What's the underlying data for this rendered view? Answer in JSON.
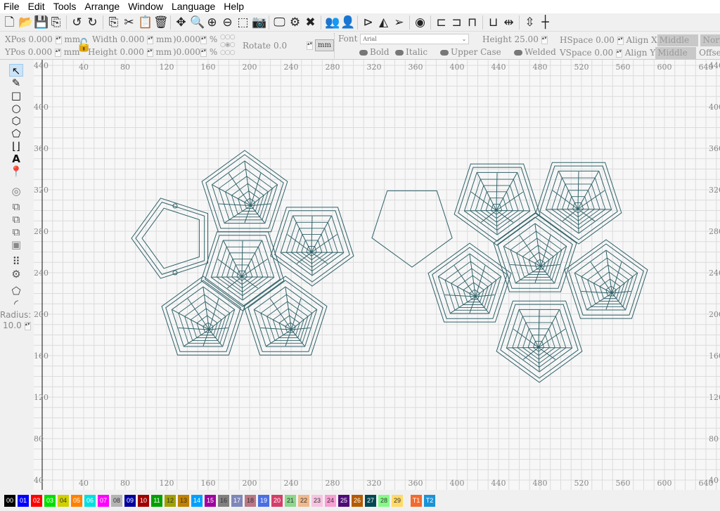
{
  "menu": [
    "File",
    "Edit",
    "Tools",
    "Arrange",
    "Window",
    "Language",
    "Help"
  ],
  "toolbar_icons": [
    "new-file",
    "open-folder",
    "save",
    "import",
    "undo",
    "redo",
    "copy",
    "cut",
    "paste",
    "delete",
    "move",
    "zoom-fit",
    "zoom-in",
    "zoom-out",
    "select-region",
    "camera",
    "monitor",
    "settings",
    "tools",
    "group",
    "user",
    "mirror-h",
    "mirror-v",
    "send",
    "target",
    "align-left",
    "align-center",
    "align-top",
    "align-middle",
    "distribute-h",
    "distribute-v",
    "dock"
  ],
  "props": {
    "xpos_label": "XPos",
    "xpos": "0.000",
    "ypos_label": "YPos",
    "ypos": "0.000",
    "unit": "mm",
    "width_label": "Width",
    "width": "0.000",
    "height_label": "Height",
    "height": "0.000",
    "scale_w": ")0.000",
    "scale_h": ")0.000",
    "pct": "%",
    "rotate_label": "Rotate",
    "rotate": "0.0",
    "units_button": "mm",
    "font_label": "Font",
    "font": "Arial",
    "text_height_label": "Height",
    "text_height": "25.00",
    "hspace_label": "HSpace",
    "hspace": "0.00",
    "vspace_label": "VSpace",
    "vspace": "0.00",
    "alignx_label": "Align X",
    "alignx": "Middle",
    "aligny_label": "Align Y",
    "aligny": "Middle",
    "normal": "Norma",
    "offset": "Offse",
    "bold": "Bold",
    "italic": "Italic",
    "upper": "Upper Case",
    "welded": "Welded"
  },
  "left_tools": {
    "radius_label": "Radius:",
    "radius": "10.0"
  },
  "ruler": {
    "x_ticks": [
      "40",
      "80",
      "120",
      "160",
      "200",
      "240",
      "280",
      "320",
      "360",
      "400",
      "440",
      "480",
      "520",
      "560",
      "600",
      "640"
    ],
    "y_ticks": [
      "440",
      "400",
      "360",
      "320",
      "280",
      "240",
      "200",
      "160",
      "120",
      "80",
      "40"
    ]
  },
  "stroke_color": "#2f6168",
  "palette": [
    {
      "l": "00",
      "c": "#000000"
    },
    {
      "l": "01",
      "c": "#0000ff"
    },
    {
      "l": "02",
      "c": "#ff0000"
    },
    {
      "l": "03",
      "c": "#00e000"
    },
    {
      "l": "04",
      "c": "#d0d000"
    },
    {
      "l": "05",
      "c": "#ff8000"
    },
    {
      "l": "06",
      "c": "#00e0e0"
    },
    {
      "l": "07",
      "c": "#ff00ff"
    },
    {
      "l": "08",
      "c": "#b4b4b4"
    },
    {
      "l": "09",
      "c": "#0000a0"
    },
    {
      "l": "10",
      "c": "#a00000"
    },
    {
      "l": "11",
      "c": "#00a000"
    },
    {
      "l": "12",
      "c": "#a0a000"
    },
    {
      "l": "13",
      "c": "#c08000"
    },
    {
      "l": "14",
      "c": "#00a0ff"
    },
    {
      "l": "15",
      "c": "#a000a0"
    },
    {
      "l": "16",
      "c": "#808080"
    },
    {
      "l": "17",
      "c": "#7d87b9"
    },
    {
      "l": "18",
      "c": "#bb7784"
    },
    {
      "l": "19",
      "c": "#4a6fe3"
    },
    {
      "l": "20",
      "c": "#d33f6a"
    },
    {
      "l": "21",
      "c": "#8cd78c"
    },
    {
      "l": "22",
      "c": "#f0b98d"
    },
    {
      "l": "23",
      "c": "#f6c4e1"
    },
    {
      "l": "24",
      "c": "#fa9ed4"
    },
    {
      "l": "25",
      "c": "#500a78"
    },
    {
      "l": "26",
      "c": "#b45a00"
    },
    {
      "l": "27",
      "c": "#004754"
    },
    {
      "l": "28",
      "c": "#86fa88"
    },
    {
      "l": "29",
      "c": "#ffdb66"
    },
    {
      "l": "T1",
      "c": "#f26b2e"
    },
    {
      "l": "T2",
      "c": "#1a93d8"
    }
  ]
}
